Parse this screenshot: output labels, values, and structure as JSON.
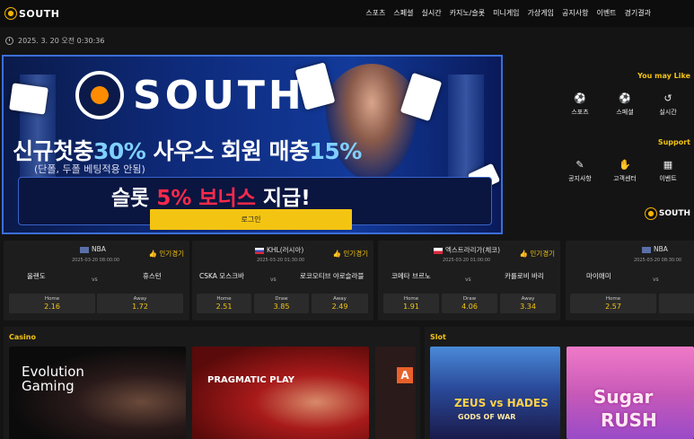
{
  "brand": {
    "name": "SOUTH"
  },
  "nav": [
    "스포츠",
    "스페셜",
    "실시간",
    "카지노/슬롯",
    "미니게임",
    "가상게임",
    "공지사항",
    "이벤트",
    "경기결과"
  ],
  "clock": "2025. 3. 20 오전 0:30:36",
  "banner": {
    "brand": "SOUTH",
    "headline_a": "신규첫충",
    "headline_pct_a": "30%",
    "headline_b": " 사우스 회원 매충",
    "headline_pct_b": "15%",
    "sub": "(단폴, 두폴 베팅적용 안됨)",
    "slot_a": "슬롯 ",
    "slot_red": "5% 보너스",
    "slot_b": " 지급!",
    "login": "로그인"
  },
  "side": {
    "you_may_like": "You may Like",
    "items1": [
      {
        "label": "스포츠",
        "icon": "soccer-ball-icon"
      },
      {
        "label": "스페셜",
        "icon": "special-ball-icon"
      },
      {
        "label": "실시간",
        "icon": "history-icon"
      }
    ],
    "support": "Support",
    "items2": [
      {
        "label": "공지사항",
        "icon": "notice-icon"
      },
      {
        "label": "고객센터",
        "icon": "support-icon"
      },
      {
        "label": "이벤트",
        "icon": "event-icon"
      }
    ],
    "logo": "SOUTH"
  },
  "hot_label": "인기경기",
  "matches": [
    {
      "league": "NBA",
      "date": "2025-03-20 08:00:00",
      "home": "올랜도",
      "away": "휴스턴",
      "vs": "vs",
      "odds": [
        {
          "label": "Home",
          "value": "2.16"
        },
        {
          "label": "Away",
          "value": "1.72"
        }
      ]
    },
    {
      "league": "KHL(러시아)",
      "date": "2025-03-20 01:30:00",
      "home": "CSKA 모스크바",
      "away": "로코모티브 야로슬라블",
      "vs": "vs",
      "odds": [
        {
          "label": "Home",
          "value": "2.51"
        },
        {
          "label": "Draw",
          "value": "3.85"
        },
        {
          "label": "Away",
          "value": "2.49"
        }
      ]
    },
    {
      "league": "엑스트라리가(체코)",
      "date": "2025-03-20 01:00:00",
      "home": "코메타 브르노",
      "away": "카를로비 바리",
      "vs": "vs",
      "odds": [
        {
          "label": "Home",
          "value": "1.91"
        },
        {
          "label": "Draw",
          "value": "4.06"
        },
        {
          "label": "Away",
          "value": "3.34"
        }
      ]
    },
    {
      "league": "NBA",
      "date": "2025-03-20 08:30:00",
      "home": "마이애미",
      "away": "",
      "vs": "vs",
      "odds": [
        {
          "label": "Home",
          "value": "2.57"
        }
      ]
    }
  ],
  "casino": {
    "title": "Casino",
    "games": [
      "Evolution\nGaming",
      "PRAGMATIC PLAY",
      "A"
    ]
  },
  "slot": {
    "title": "Slot",
    "games": [
      "ZEUS vs HADES",
      "GODS OF WAR",
      "Sugar",
      "RUSH"
    ]
  },
  "colors": {
    "accent": "#f3c412",
    "bg": "#141414"
  }
}
